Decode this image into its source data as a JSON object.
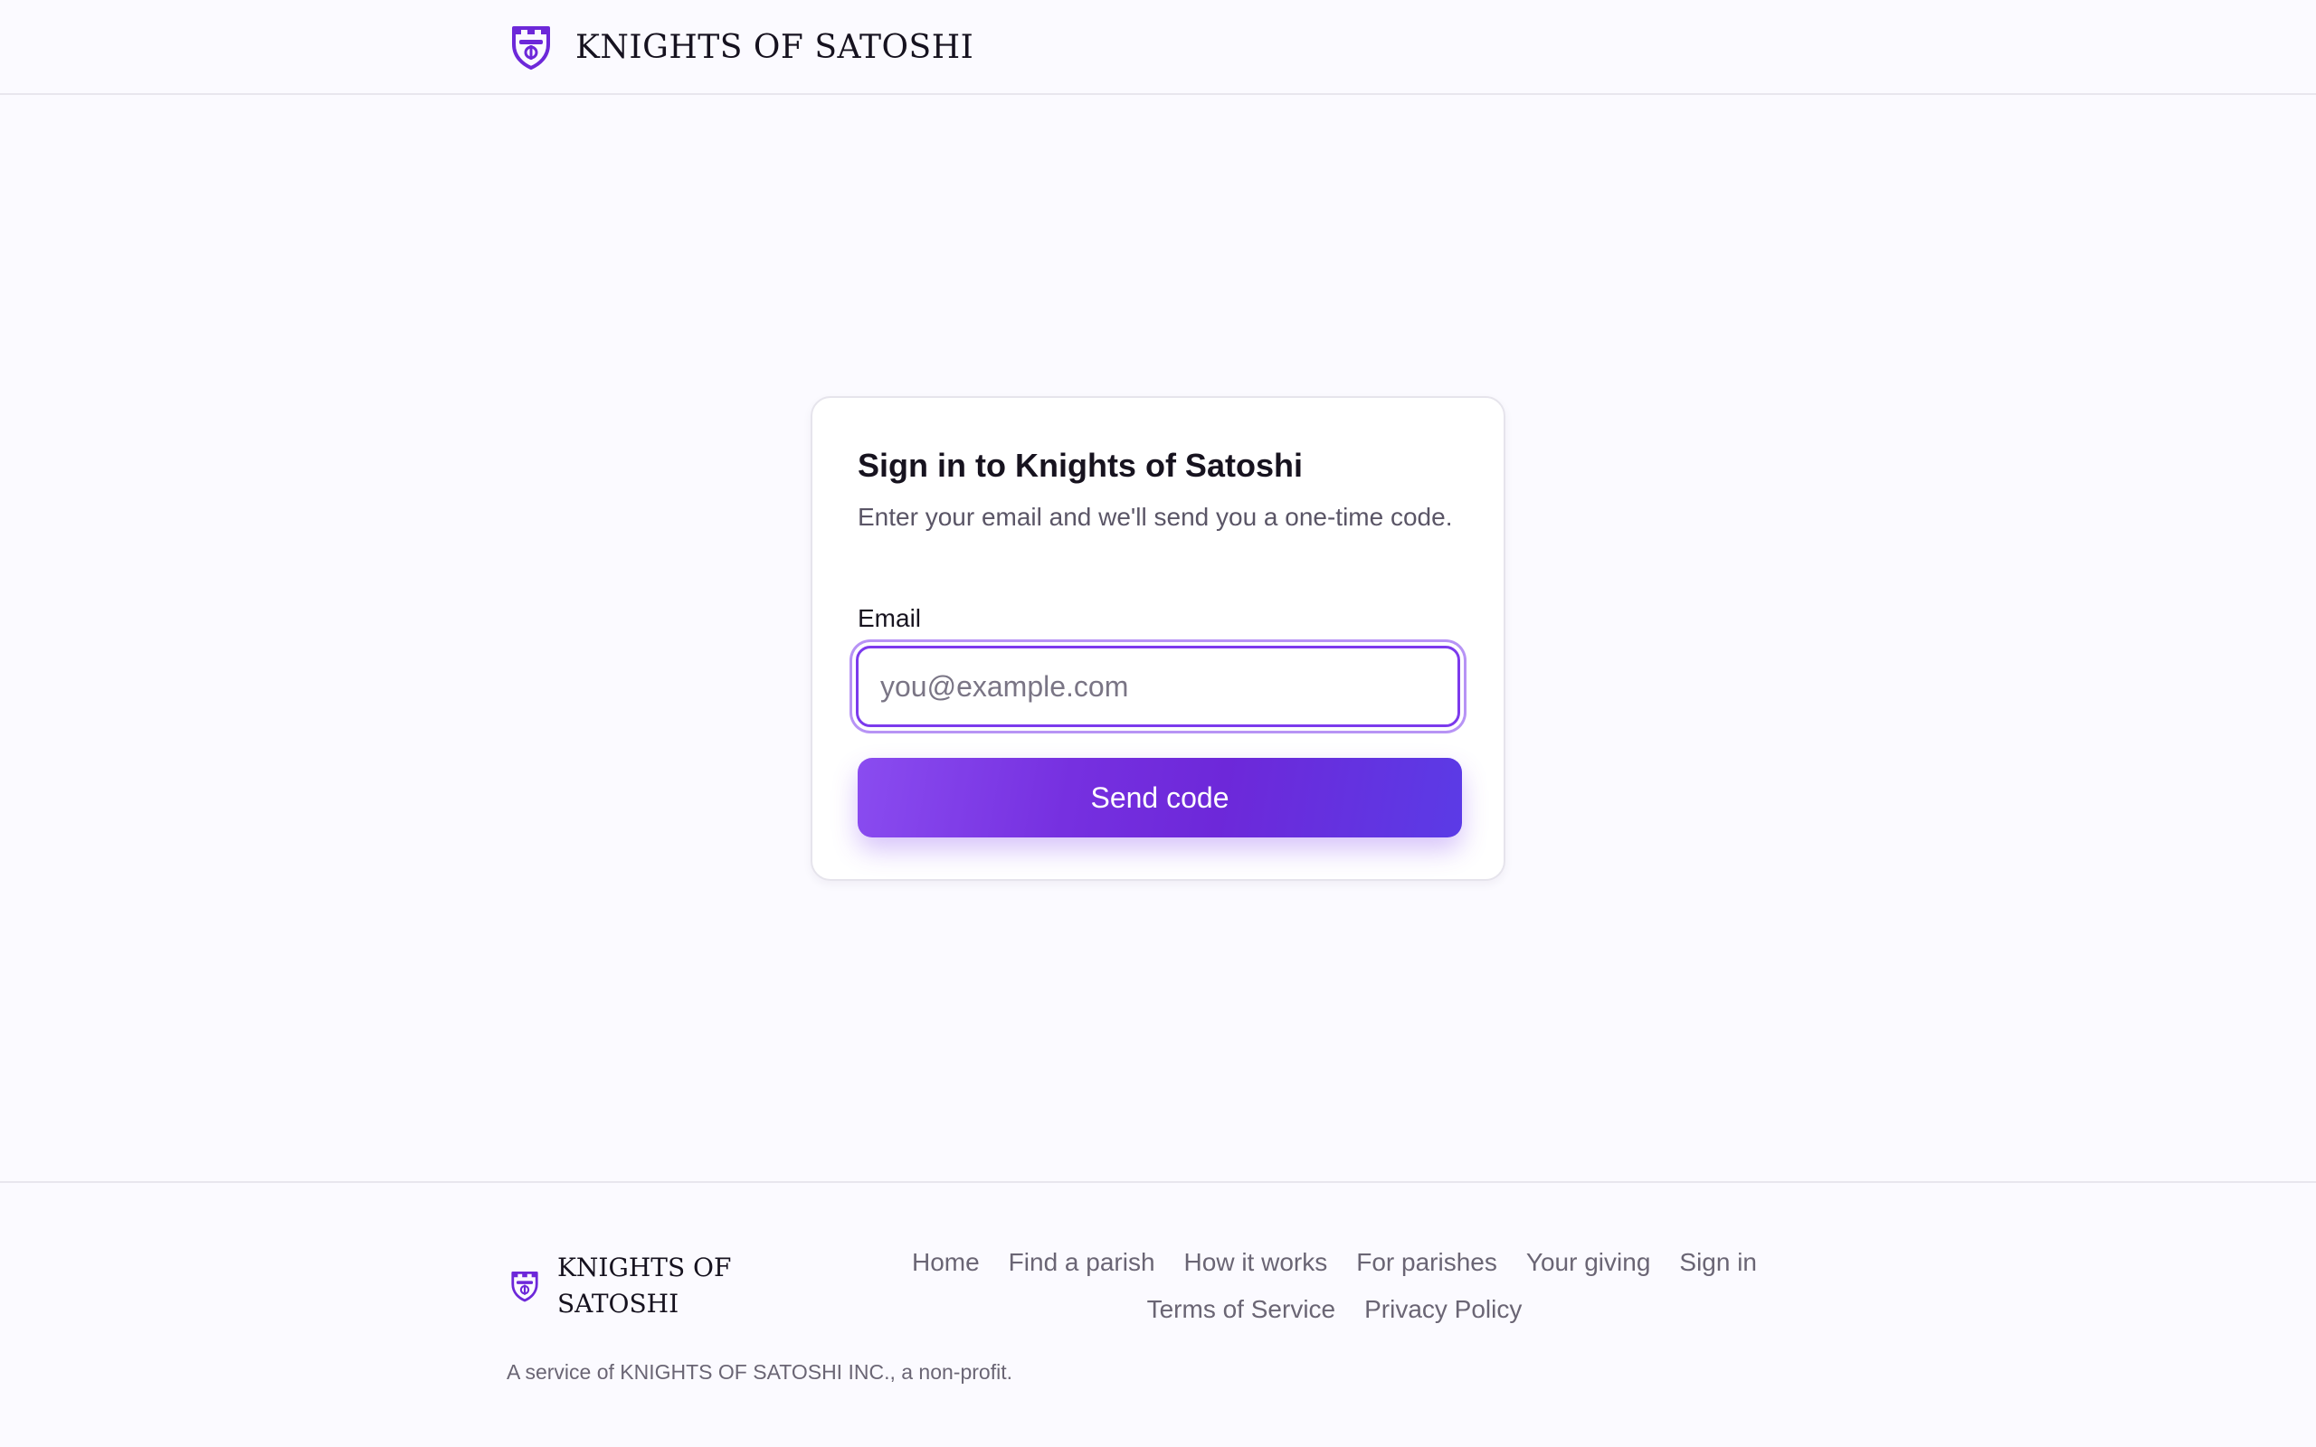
{
  "header": {
    "brand_title": "KNIGHTS OF SATOSHI",
    "logo_icon": "shield-icon"
  },
  "signin": {
    "title": "Sign in to Knights of Satoshi",
    "subtitle": "Enter your email and we'll send you a one-time code.",
    "email_label": "Email",
    "email_value": "",
    "email_placeholder": "you@example.com",
    "submit_label": "Send code"
  },
  "footer": {
    "brand_title": "KNIGHTS OF SATOSHI",
    "links": [
      {
        "label": "Home"
      },
      {
        "label": "Find a parish"
      },
      {
        "label": "How it works"
      },
      {
        "label": "For parishes"
      },
      {
        "label": "Your giving"
      },
      {
        "label": "Sign in"
      },
      {
        "label": "Terms of Service"
      },
      {
        "label": "Privacy Policy"
      }
    ],
    "note": "A service of KNIGHTS OF SATOSHI INC., a non-profit."
  },
  "colors": {
    "accent": "#7c3aed",
    "accent_dark": "#6d28d9",
    "background": "#fbfaff",
    "text": "#17131f",
    "muted": "#6a6574"
  }
}
